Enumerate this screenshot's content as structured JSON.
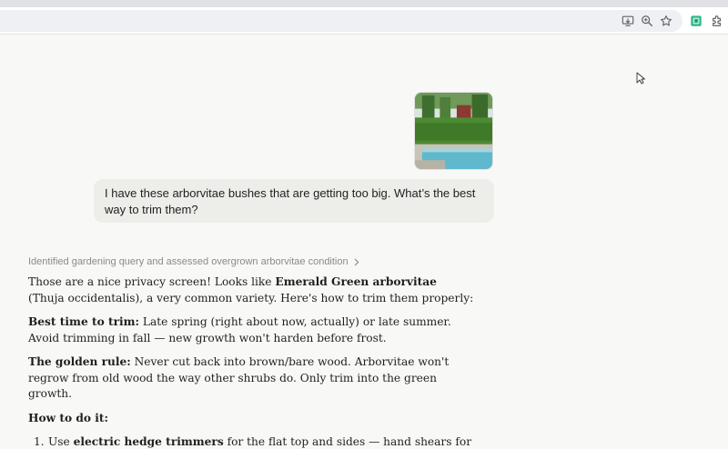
{
  "browser": {
    "toolbar_icons": [
      "install-app-icon",
      "zoom-icon",
      "bookmark-star-icon",
      "extension-badge-icon",
      "extensions-puzzle-icon"
    ]
  },
  "conversation": {
    "user_image": {
      "description_icon": "photo-thumbnail"
    },
    "user_message": "I have these arborvitae bushes that are getting too big. What’s the best way to trim them?",
    "thinking_summary": "Identified gardening query and assessed overgrown arborvitae condition",
    "response": {
      "p1": {
        "pre": "Those are a nice privacy screen! Looks like ",
        "bold": "Emerald Green arborvitae",
        "post": " (Thuja occidentalis), a very common variety. Here's how to trim them properly:"
      },
      "p2": {
        "bold": "Best time to trim:",
        "post": " Late spring (right about now, actually) or late summer. Avoid trimming in fall — new growth won't harden before frost."
      },
      "p3": {
        "bold": "The golden rule:",
        "post": " Never cut back into brown/bare wood. Arborvitae won't regrow from old wood the way other shrubs do. Only trim into the green growth."
      },
      "p4": {
        "bold": "How to do it:"
      },
      "list": [
        {
          "num": "1.",
          "pre": "Use ",
          "bold": "electric hedge trimmers",
          "post": " for the flat top and sides — hand shears for detail work near the base or between shrubs."
        }
      ]
    }
  }
}
